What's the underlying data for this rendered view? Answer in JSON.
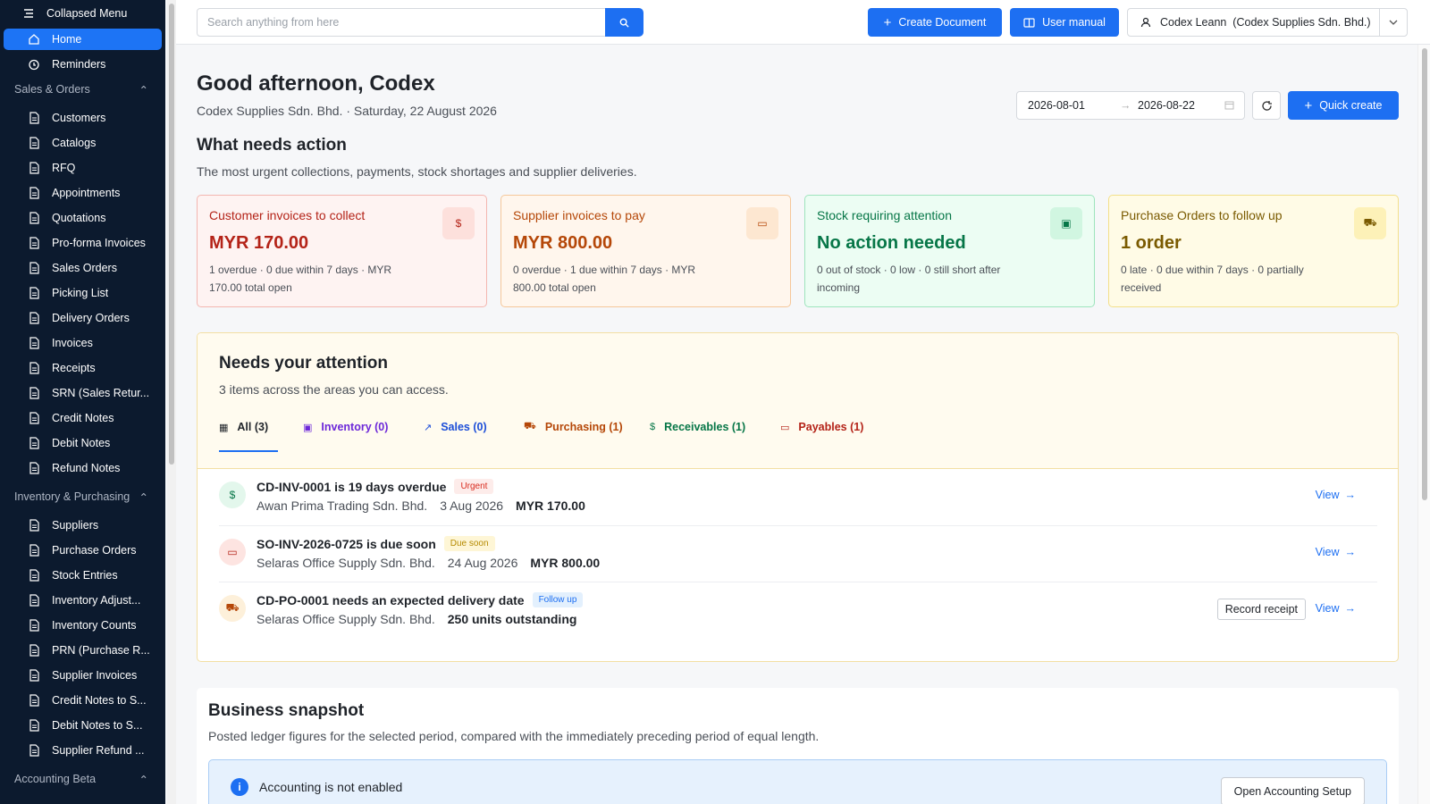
{
  "sidebar": {
    "collapse_label": "Collapsed Menu",
    "top_items": [
      {
        "label": "Home",
        "icon": "home-icon"
      },
      {
        "label": "Reminders",
        "icon": "alarm-icon"
      }
    ],
    "sections": [
      {
        "label": "Sales & Orders"
      },
      {
        "label": "Inventory & Purchasing"
      },
      {
        "label": "Accounting Beta"
      }
    ],
    "sales_items": [
      {
        "label": "Customers"
      },
      {
        "label": "Catalogs"
      },
      {
        "label": "RFQ"
      },
      {
        "label": "Appointments"
      },
      {
        "label": "Quotations"
      },
      {
        "label": "Pro-forma Invoices"
      },
      {
        "label": "Sales Orders"
      },
      {
        "label": "Picking List"
      },
      {
        "label": "Delivery Orders"
      },
      {
        "label": "Invoices"
      },
      {
        "label": "Receipts"
      },
      {
        "label": "SRN (Sales Retur..."
      },
      {
        "label": "Credit Notes"
      },
      {
        "label": "Debit Notes"
      },
      {
        "label": "Refund Notes"
      }
    ],
    "inventory_items": [
      {
        "label": "Suppliers"
      },
      {
        "label": "Purchase Orders"
      },
      {
        "label": "Stock Entries"
      },
      {
        "label": "Inventory Adjust..."
      },
      {
        "label": "Inventory Counts"
      },
      {
        "label": "PRN (Purchase R..."
      },
      {
        "label": "Supplier Invoices"
      },
      {
        "label": "Credit Notes to S..."
      },
      {
        "label": "Debit Notes to S..."
      },
      {
        "label": "Supplier Refund ..."
      }
    ]
  },
  "topbar": {
    "search_placeholder": "Search anything from here",
    "create_document": "Create Document",
    "user_manual": "User manual",
    "user": "Codex Leann  (Codex Supplies Sdn. Bhd.)"
  },
  "header": {
    "greeting": "Good afternoon, Codex",
    "subtitle": "Codex Supplies Sdn. Bhd. · Saturday, 22 August 2026",
    "date_from": "2026-08-01",
    "date_to": "2026-08-22",
    "quick_create": "Quick create"
  },
  "action": {
    "title": "What needs action",
    "subtitle": "The most urgent collections, payments, stock shortages and supplier deliveries.",
    "cards": [
      {
        "title": "Customer invoices to collect",
        "value": "MYR 170.00",
        "desc": "1 overdue · 0 due within 7 days · MYR 170.00 total open",
        "color": "#b42318",
        "bg": "#fef3f2",
        "border": "#f3b6b0",
        "iconbg": "#fde0dc"
      },
      {
        "title": "Supplier invoices to pay",
        "value": "MYR 800.00",
        "desc": "0 overdue · 1 due within 7 days · MYR 800.00 total open",
        "color": "#b54708",
        "bg": "#fff6ed",
        "border": "#f5c79a",
        "iconbg": "#fde7d1"
      },
      {
        "title": "Stock requiring attention",
        "value": "No action needed",
        "desc": "0 out of stock · 0 low · 0 still short after incoming",
        "color": "#067647",
        "bg": "#ecfdf3",
        "border": "#9ee4bd",
        "iconbg": "#d1f6e1"
      },
      {
        "title": "Purchase Orders to follow up",
        "value": "1 order",
        "desc": "0 late · 0 due within 7 days · 0 partially received",
        "color": "#7a5a00",
        "bg": "#fffbe6",
        "border": "#f3e08a",
        "iconbg": "#fdf1b8"
      }
    ]
  },
  "attention": {
    "title": "Needs your attention",
    "subtitle": "3 items across the areas you can access.",
    "tabs": [
      {
        "label": "All (3)",
        "color": "#1f2329"
      },
      {
        "label": "Inventory (0)",
        "color": "#6d28d9"
      },
      {
        "label": "Sales (0)",
        "color": "#1d4ed8"
      },
      {
        "label": "Purchasing (1)",
        "color": "#b54708"
      },
      {
        "label": "Receivables (1)",
        "color": "#067647"
      },
      {
        "label": "Payables (1)",
        "color": "#b42318"
      }
    ],
    "rows": [
      {
        "title": "CD-INV-0001 is 19 days overdue",
        "badge": "Urgent",
        "party": "Awan Prima Trading Sdn. Bhd.",
        "date": "3 Aug 2026",
        "amount": "MYR 170.00",
        "view": "View"
      },
      {
        "title": "SO-INV-2026-0725 is due soon",
        "badge": "Due soon",
        "party": "Selaras Office Supply Sdn. Bhd.",
        "date": "24 Aug 2026",
        "amount": "MYR 800.00",
        "view": "View"
      },
      {
        "title": "CD-PO-0001 needs an expected delivery date",
        "badge": "Follow up",
        "party": "Selaras Office Supply Sdn. Bhd.",
        "amount": "250 units outstanding",
        "action": "Record receipt",
        "view": "View"
      }
    ]
  },
  "snapshot": {
    "title": "Business snapshot",
    "subtitle": "Posted ledger figures for the selected period, compared with the immediately preceding period of equal length.",
    "info": "Accounting is not enabled",
    "button": "Open Accounting Setup"
  },
  "colors": {
    "accent": "#1d6ff2",
    "sidebar": "#0c1a2e"
  }
}
